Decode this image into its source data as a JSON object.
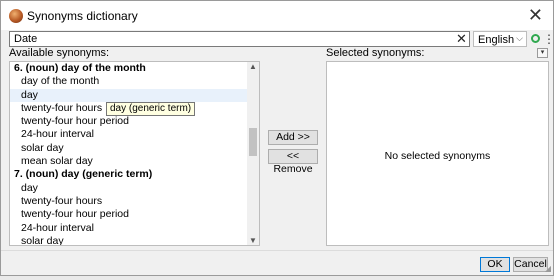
{
  "window": {
    "title": "Synonyms dictionary"
  },
  "search": {
    "value": "Date",
    "language": "English"
  },
  "available": {
    "label": "Available synonyms:",
    "rows": [
      {
        "text": "6. (noun) day of the month",
        "type": "header"
      },
      {
        "text": "day of the month",
        "type": "item"
      },
      {
        "text": "day",
        "type": "item",
        "hover": true
      },
      {
        "text": "twenty-four hours",
        "type": "item"
      },
      {
        "text": "twenty-four hour period",
        "type": "item"
      },
      {
        "text": "24-hour interval",
        "type": "item"
      },
      {
        "text": "solar day",
        "type": "item"
      },
      {
        "text": "mean solar day",
        "type": "item"
      },
      {
        "text": "7. (noun) day (generic term)",
        "type": "header"
      },
      {
        "text": "day",
        "type": "item"
      },
      {
        "text": "twenty-four hours",
        "type": "item"
      },
      {
        "text": "twenty-four hour period",
        "type": "item"
      },
      {
        "text": "24-hour interval",
        "type": "item"
      },
      {
        "text": "solar day",
        "type": "item"
      }
    ],
    "tooltip": "day (generic term)"
  },
  "actions": {
    "add": "Add >>",
    "remove": "<< Remove"
  },
  "selected": {
    "label": "Selected synonyms:",
    "empty_text": "No selected synonyms"
  },
  "footer": {
    "ok": "OK",
    "cancel": "Cancel"
  },
  "colors": {
    "accent": "#0078d7",
    "hover_row": "#e8f1fb",
    "tooltip_bg": "#ffffe1",
    "status_ok": "#2fa84f"
  },
  "icons": {
    "app": "dictionary-app-icon",
    "close": "close-icon",
    "clear": "clear-icon",
    "dropdown": "chevron-down-icon",
    "status": "check-circle-icon",
    "more": "more-vertical-icon",
    "resize": "resize-grip-icon"
  }
}
